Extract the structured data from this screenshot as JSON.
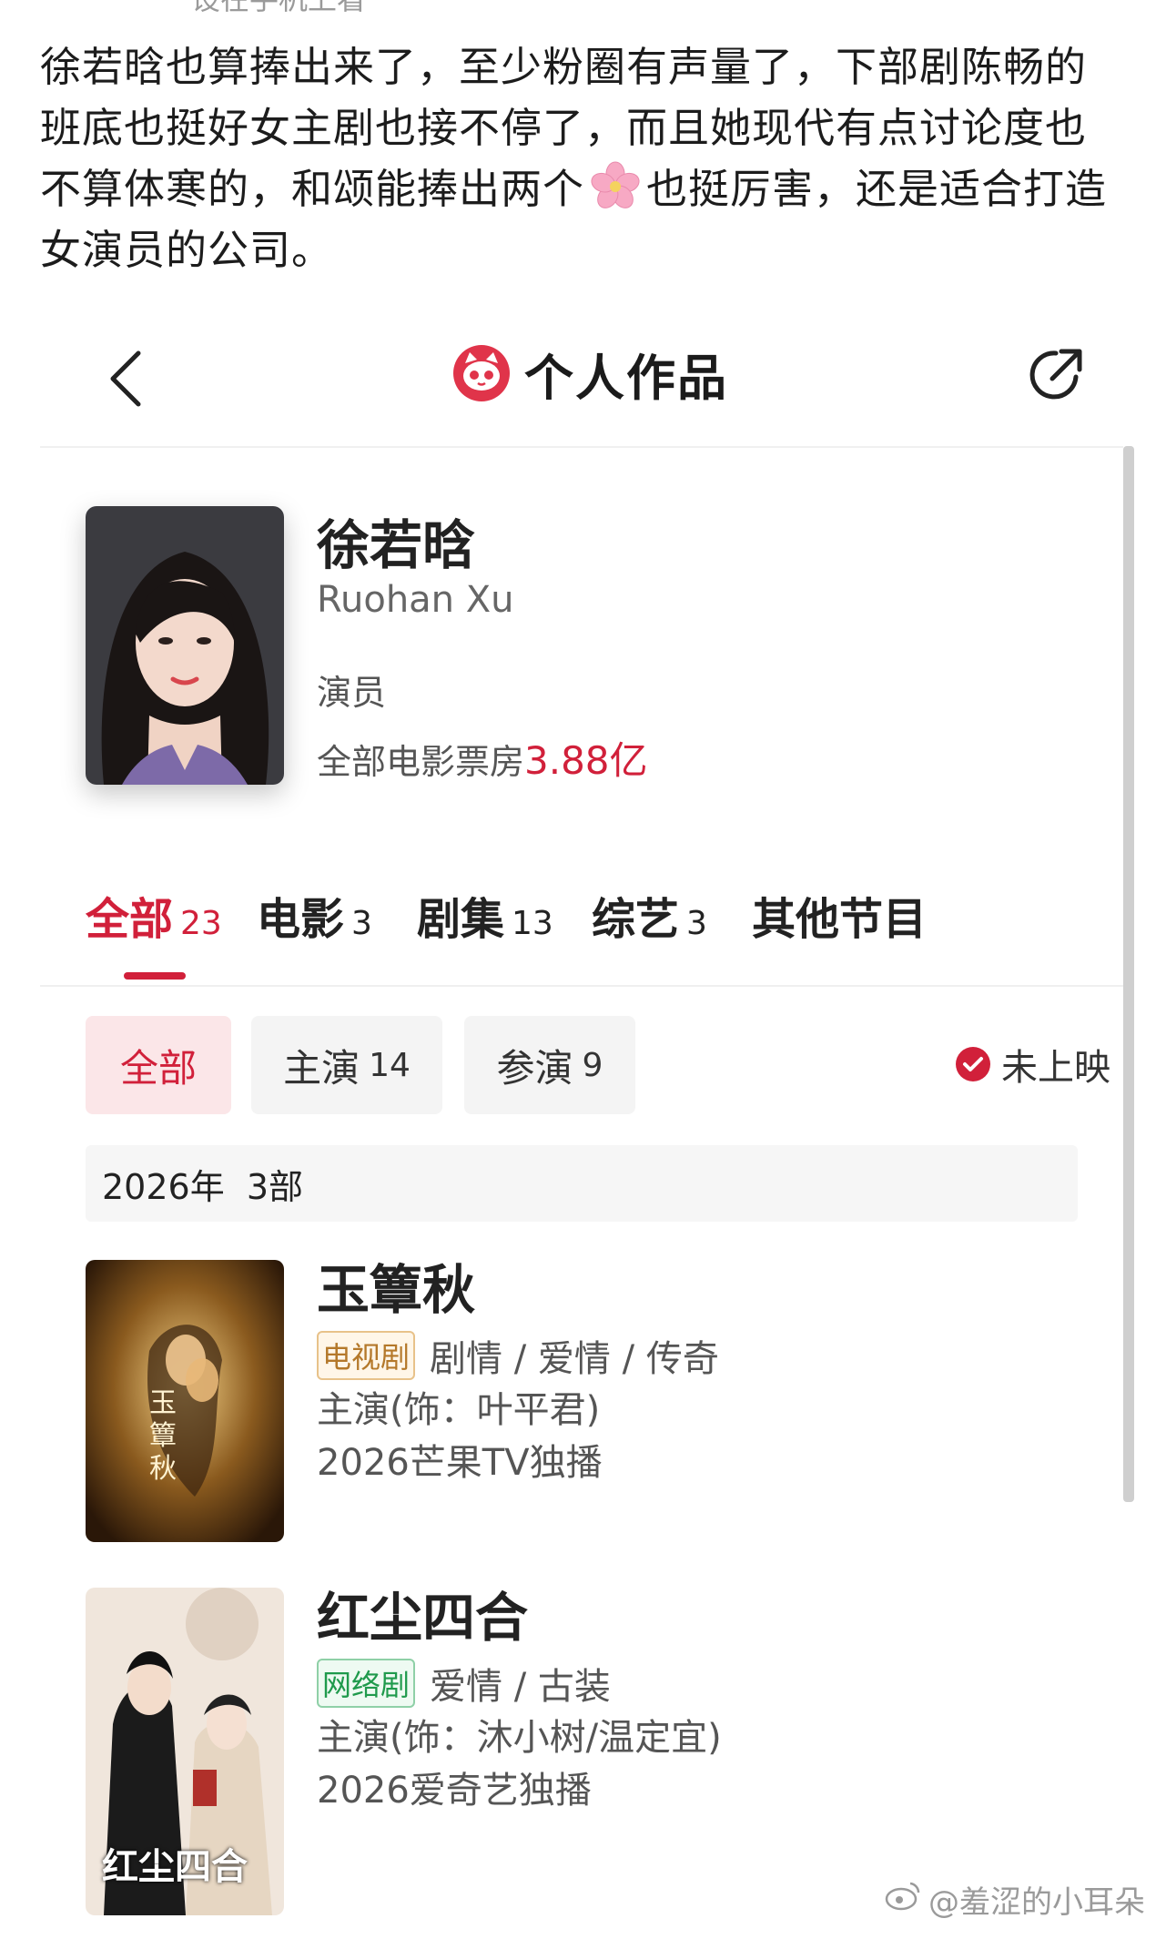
{
  "post": {
    "cut_text": "设在手机上看",
    "text_before_emoji": "徐若晗也算捧出来了，至少粉圈有声量了，下部剧陈畅的班底也挺好女主剧也接不停了，而且她现代有点讨论度也不算体寒的，和颂能捧出两个",
    "emoji_icon": "cherry-blossom-icon",
    "text_after_emoji": "也挺厉害，还是适合打造女演员的公司。"
  },
  "app": {
    "title": "个人作品",
    "logo_icon": "cat-eye-logo-icon",
    "accent_color": "#d1203a"
  },
  "profile": {
    "name": "徐若晗",
    "en_name": "Ruohan Xu",
    "role": "演员",
    "boxoffice_label": "全部电影票房",
    "boxoffice_value": "3.88亿"
  },
  "tabs": [
    {
      "label": "全部",
      "count": "23",
      "active": true
    },
    {
      "label": "电影",
      "count": "3"
    },
    {
      "label": "剧集",
      "count": "13"
    },
    {
      "label": "综艺",
      "count": "3"
    },
    {
      "label": "其他节目",
      "count": ""
    }
  ],
  "filters": {
    "chips": [
      {
        "label": "全部",
        "count": "",
        "active": true
      },
      {
        "label": "主演",
        "count": "14"
      },
      {
        "label": "参演",
        "count": "9"
      }
    ],
    "unreleased_label": "未上映"
  },
  "year_group": {
    "label": "2026年  3部"
  },
  "works": [
    {
      "title": "玉簟秋",
      "poster_text": "玉簟秋",
      "badge": "电视剧",
      "genres": "剧情 / 爱情 / 传奇",
      "role": "主演(饰：叶平君)",
      "release": "2026芒果TV独播"
    },
    {
      "title": "红尘四合",
      "poster_text": "红尘四合",
      "badge": "网络剧",
      "genres": "爱情 / 古装",
      "role": "主演(饰：沐小树/温定宜)",
      "release": "2026爱奇艺独播"
    }
  ],
  "watermark": "@羞涩的小耳朵"
}
